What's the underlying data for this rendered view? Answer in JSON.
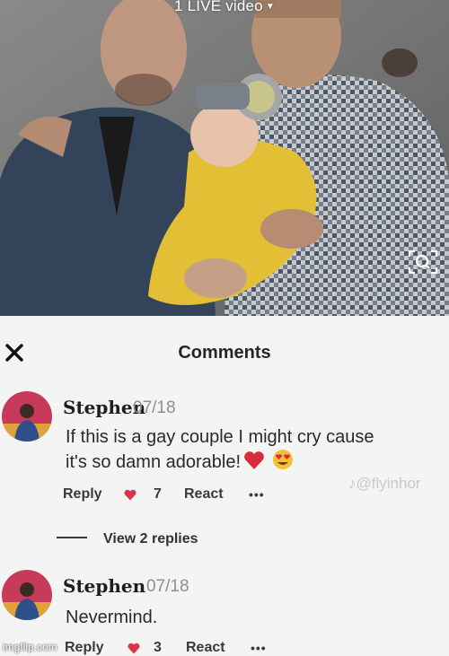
{
  "video": {
    "live_label": "1 LIVE video"
  },
  "panel": {
    "title": "Comments"
  },
  "comments": [
    {
      "author": "Stephen",
      "date": "07/18",
      "text_line1": "If this is a gay couple I might cry cause",
      "text_line2": "it's so damn adorable!",
      "reply_label": "Reply",
      "likes": "7",
      "react_label": "React",
      "more": "•••"
    },
    {
      "author": "Stephen",
      "date": "07/18",
      "text_line1": "Nevermind.",
      "reply_label": "Reply",
      "likes": "3",
      "react_label": "React",
      "more": "•••"
    }
  ],
  "view_replies": {
    "label": "View 2 replies"
  },
  "watermark": {
    "text": "@flyinhor"
  },
  "footer": {
    "source": "imgflip.com"
  },
  "colors": {
    "heart": "#d9344b",
    "panel_bg": "#f4f4f4",
    "avatar_bg": "#c83a5a"
  }
}
